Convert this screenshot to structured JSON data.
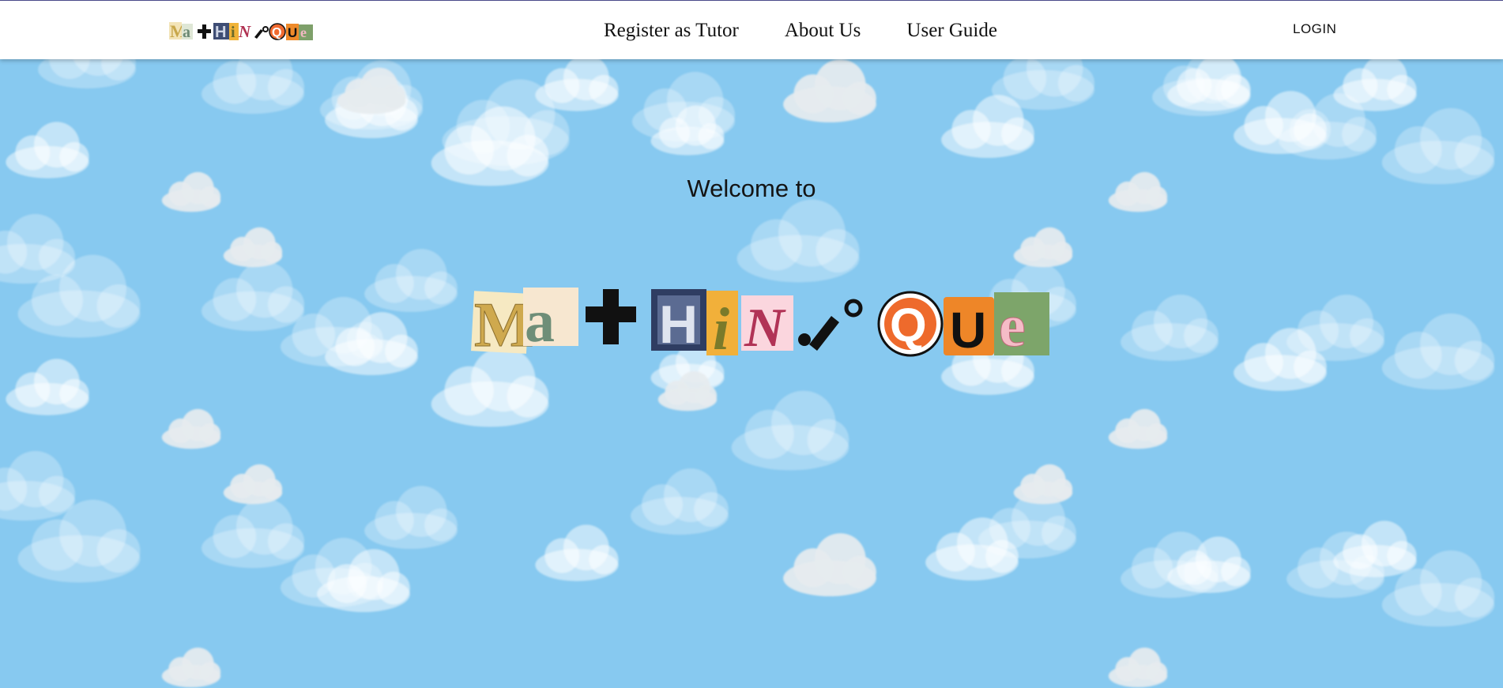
{
  "header": {
    "logo_alt": "Mathinque",
    "nav": [
      {
        "label": "Register as Tutor"
      },
      {
        "label": "About Us"
      },
      {
        "label": "User Guide"
      }
    ],
    "login_label": "LOGIN"
  },
  "hero": {
    "welcome_text": "Welcome to",
    "logo_alt": "Mathinque"
  },
  "colors": {
    "sky": "#87c9f0",
    "cloud": "#e8eef0",
    "navbar_bg": "#ffffff"
  }
}
